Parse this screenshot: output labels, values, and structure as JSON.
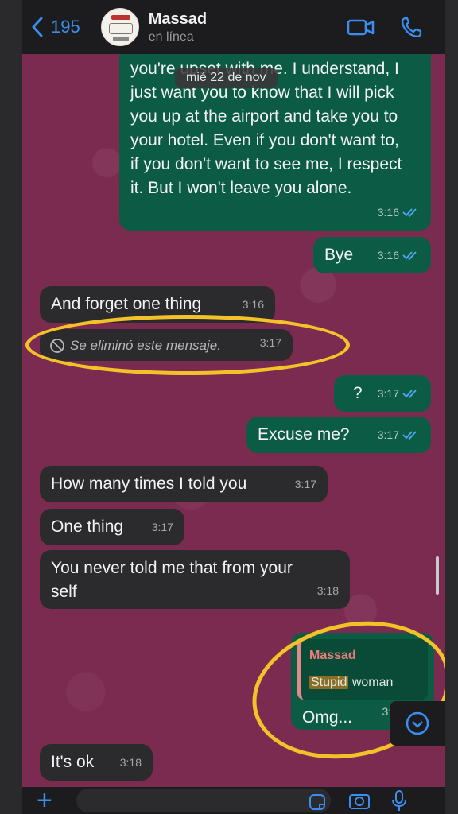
{
  "header": {
    "back_count": "195",
    "contact_name": "Massad",
    "status": "en línea"
  },
  "date_pill": "mié 22 de nov",
  "messages": [
    {
      "dir": "out",
      "text": "you're upset with me. I understand, I just want you to know that I will pick you up at the airport and take you to your hotel. Even if you don't want to, if you don't want to see me, I respect it. But I won't leave you alone.",
      "time": "3:16"
    },
    {
      "dir": "out",
      "text": "Bye",
      "time": "3:16"
    },
    {
      "dir": "in",
      "text": "And forget one thing",
      "time": "3:16"
    },
    {
      "dir": "in",
      "text": "Se eliminó este mensaje.",
      "time": "3:17",
      "deleted": true
    },
    {
      "dir": "out",
      "text": "?",
      "time": "3:17"
    },
    {
      "dir": "out",
      "text": "Excuse me?",
      "time": "3:17"
    },
    {
      "dir": "in",
      "text": "How many times I told you",
      "time": "3:17"
    },
    {
      "dir": "in",
      "text": "One thing",
      "time": "3:17"
    },
    {
      "dir": "in",
      "text": "You never told me that from your self",
      "time": "3:18"
    },
    {
      "dir": "out",
      "text": "Omg...",
      "time": "3:1",
      "quote": {
        "author": "Massad",
        "highlight": "Stupid",
        "rest": " woman"
      }
    },
    {
      "dir": "in",
      "text": "It's ok",
      "time": "3:18"
    }
  ],
  "colors": {
    "accent": "#3a8ef0",
    "outgoing": "#0c5c45",
    "incoming": "#2b2b2d",
    "wallpaper": "#7c2b50",
    "annotation": "#f2c228"
  }
}
